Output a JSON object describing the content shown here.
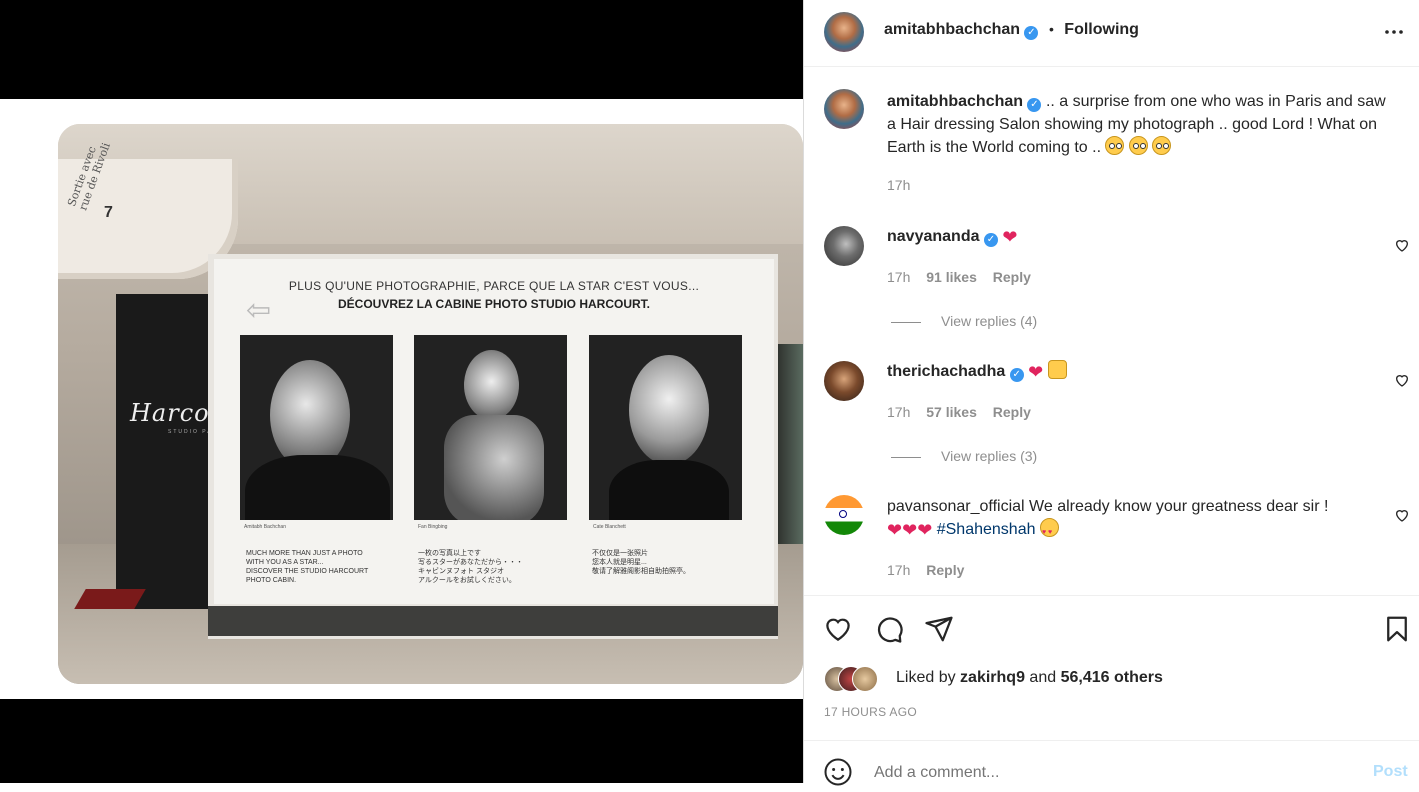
{
  "media": {
    "poster_line1": "PLUS QU'UNE PHOTOGRAPHIE, PARCE QUE LA STAR C'EST VOUS...",
    "poster_line2": "DÉCOUVREZ LA CABINE PHOTO STUDIO HARCOURT.",
    "booth_logo": "Harcou",
    "booth_sub": "STUDIO PAR",
    "arch_text": "Sortie avec\nrue de Rivoli",
    "arch_number": "7",
    "caption_1": "Amitabh Bachchan",
    "caption_2": "Fan Bingbing",
    "caption_3": "Cate Blanchett",
    "text_en": "MUCH MORE THAN JUST A PHOTO\nWITH YOU AS A STAR...\nDISCOVER THE STUDIO HARCOURT\nPHOTO CABIN.",
    "text_jp": "一枚の写真以上です\n写るスターがあなただから・・・\nキャビンヌフォト スタジオ\nアルクールをお試しください。",
    "text_cn": "不仅仅是一张照片\n您本人就是明星...\n敬请了解雅阁影相自助拍照亭。"
  },
  "header": {
    "username": "amitabhbachchan",
    "separator": "•",
    "follow_status": "Following",
    "more_icon": "more-horizontal-icon"
  },
  "caption": {
    "username": "amitabhbachchan",
    "text": ".. a surprise from one who was in Paris and saw a Hair dressing Salon showing my photograph .. good Lord ! What on Earth is the World coming to ..",
    "time": "17h"
  },
  "comments": [
    {
      "username": "navyananda",
      "time": "17h",
      "likes": "91 likes",
      "reply": "Reply",
      "view_replies": "View replies (4)"
    },
    {
      "username": "therichachadha",
      "time": "17h",
      "likes": "57 likes",
      "reply": "Reply",
      "view_replies": "View replies (3)"
    },
    {
      "username": "pavansonar_official",
      "text": "We already know your greatness dear sir !",
      "hashtag": "#Shahenshah",
      "time": "17h",
      "reply": "Reply"
    }
  ],
  "likes": {
    "prefix": "Liked by",
    "user": "zakirhq9",
    "and": "and",
    "others": "56,416 others"
  },
  "timestamp": "17 HOURS AGO",
  "add_comment": {
    "placeholder": "Add a comment...",
    "post_label": "Post"
  },
  "colors": {
    "accent_blue": "#0095f6",
    "verified_blue": "#3897f0",
    "heart_red": "#ed4956",
    "muted_text": "#8e8e8e"
  }
}
